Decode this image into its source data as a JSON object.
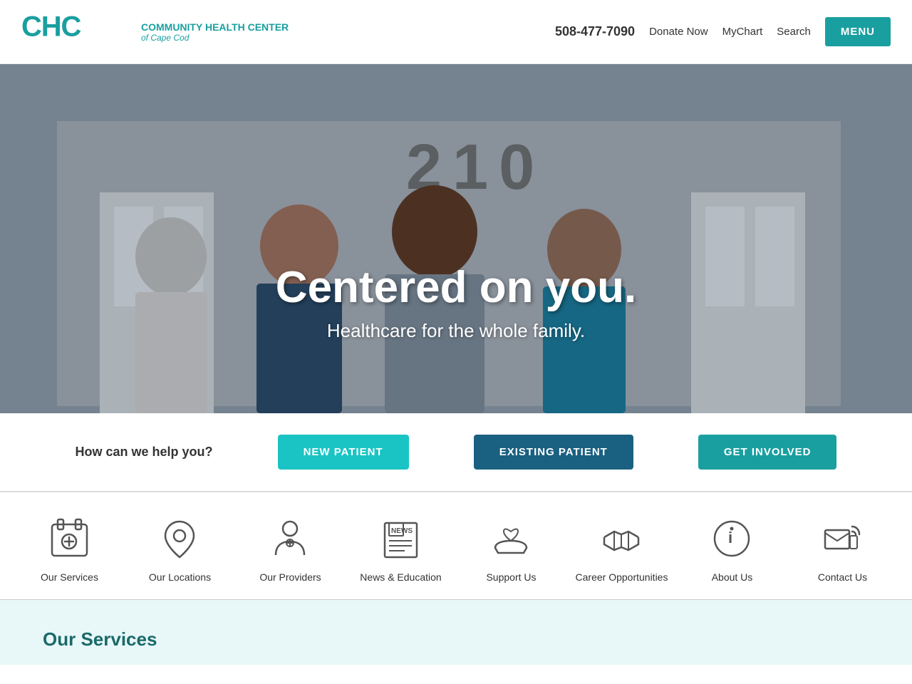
{
  "header": {
    "logo_chc": "CHC",
    "logo_title": "Community Health Center",
    "logo_subtitle": "of Cape Cod",
    "phone": "508-477-7090",
    "donate_label": "Donate Now",
    "mychart_label": "MyChart",
    "search_label": "Search",
    "menu_label": "MENU"
  },
  "hero": {
    "building_number": "210",
    "title": "Centered on you.",
    "subtitle": "Healthcare for the whole family."
  },
  "help_bar": {
    "question": "How can we help you?",
    "btn_new_patient": "NEW PATIENT",
    "btn_existing_patient": "EXISTING PATIENT",
    "btn_get_involved": "GET INVOLVED"
  },
  "nav_icons": [
    {
      "id": "our-services",
      "label": "Our Services",
      "icon": "services"
    },
    {
      "id": "our-locations",
      "label": "Our Locations",
      "icon": "location"
    },
    {
      "id": "our-providers",
      "label": "Our Providers",
      "icon": "provider"
    },
    {
      "id": "news-education",
      "label": "News & Education",
      "icon": "news"
    },
    {
      "id": "support-us",
      "label": "Support Us",
      "icon": "support"
    },
    {
      "id": "career-opportunities",
      "label": "Career Opportunities",
      "icon": "career"
    },
    {
      "id": "about-us",
      "label": "About Us",
      "icon": "about"
    },
    {
      "id": "contact-us",
      "label": "Contact Us",
      "icon": "contact"
    }
  ],
  "our_services": {
    "title": "Our Services"
  },
  "colors": {
    "teal": "#1a9fa0",
    "teal_light": "#1ac4c4",
    "teal_dark": "#1a6080",
    "icon_gray": "#555"
  }
}
